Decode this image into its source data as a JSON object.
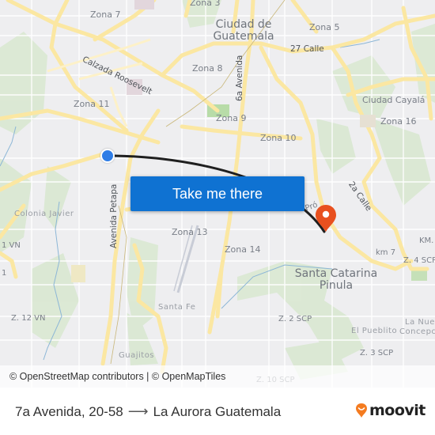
{
  "map": {
    "labels": {
      "zona7": "Zona 7",
      "zona3": "Zona 3",
      "ciudad1": "Ciudad de",
      "ciudad2": "Guatemala",
      "zona5": "Zona 5",
      "calle27": "27 Calle",
      "calzada": "Calzada Roosevelt",
      "zona8": "Zona 8",
      "avenida6": "6a Avenida",
      "zona11": "Zona 11",
      "zona9": "Zona 9",
      "cayala": "Ciudad Cayalá",
      "zona16": "Zona 16",
      "zona10": "Zona 10",
      "calle2a": "2a Calle",
      "colonia_javier": "Colonia Javier",
      "petapa": "Avenida Petapa",
      "zona13": "Zona 13",
      "zona14": "Zona 14",
      "vn1": "1 VN",
      "one": "1",
      "km": "KM.",
      "km7": "km 7",
      "z4scp": "Z. 4 SCP",
      "santa_catarina1": "Santa Catarina",
      "santa_catarina2": "Pinula",
      "z12vn": "Z. 12 VN",
      "santa_fe": "Santa Fe",
      "z2scp": "Z. 2 SCP",
      "la_nueva": "La Nue",
      "pueblito": "El Pueblito",
      "concepcion": "Concepc",
      "z3scp": "Z. 3 SCP",
      "guajitos": "Guajitos",
      "z10scp": "Z. 10 SCP",
      "pro": "Pró"
    },
    "take_me_there": "Take me there",
    "attribution": "© OpenStreetMap contributors | © OpenMapTiles",
    "colors": {
      "route_line": "#1f1f1f",
      "origin": "#2f7de6",
      "destination": "#e8501f",
      "button": "#0f72d2"
    }
  },
  "footer": {
    "origin": "7a Avenida, 20-58",
    "destination": "La Aurora Guatemala",
    "brand": "moovit"
  }
}
